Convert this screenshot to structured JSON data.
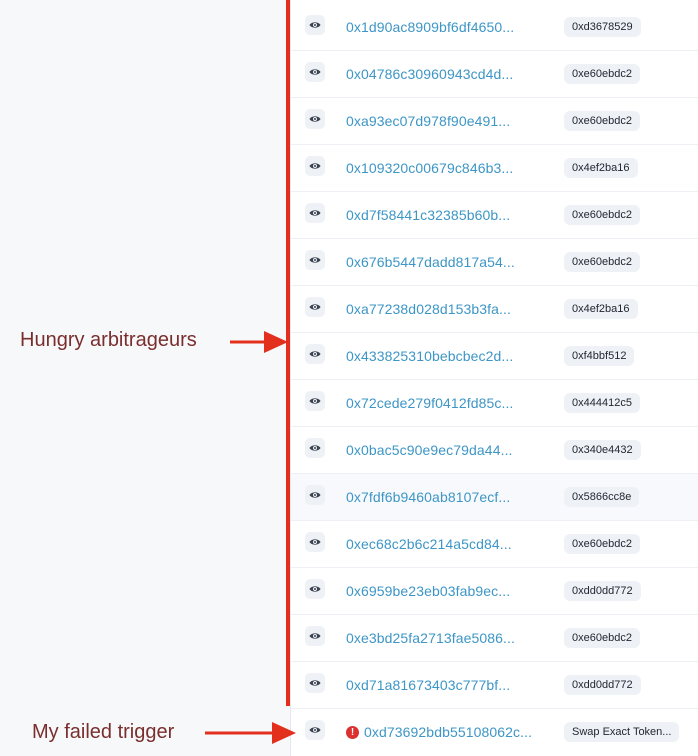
{
  "annotations": {
    "arbitrageurs": "Hungry arbitrageurs",
    "failed": "My failed trigger",
    "color": "#e3301c"
  },
  "colors": {
    "hash": "#3d96c6",
    "error": "#dc3030"
  },
  "transactions": [
    {
      "hash": "0x1d90ac8909bf6df4650...",
      "method": "0xd3678529",
      "icon": "eye-icon",
      "status": "ok"
    },
    {
      "hash": "0x04786c30960943cd4d...",
      "method": "0xe60ebdc2",
      "icon": "eye-icon",
      "status": "ok"
    },
    {
      "hash": "0xa93ec07d978f90e491...",
      "method": "0xe60ebdc2",
      "icon": "eye-icon",
      "status": "ok"
    },
    {
      "hash": "0x109320c00679c846b3...",
      "method": "0x4ef2ba16",
      "icon": "eye-icon",
      "status": "ok"
    },
    {
      "hash": "0xd7f58441c32385b60b...",
      "method": "0xe60ebdc2",
      "icon": "eye-icon",
      "status": "ok"
    },
    {
      "hash": "0x676b5447dadd817a54...",
      "method": "0xe60ebdc2",
      "icon": "eye-icon",
      "status": "ok"
    },
    {
      "hash": "0xa77238d028d153b3fa...",
      "method": "0x4ef2ba16",
      "icon": "eye-icon",
      "status": "ok"
    },
    {
      "hash": "0x433825310bebcbec2d...",
      "method": "0xf4bbf512",
      "icon": "eye-icon",
      "status": "ok"
    },
    {
      "hash": "0x72cede279f0412fd85c...",
      "method": "0x444412c5",
      "icon": "eye-icon",
      "status": "ok"
    },
    {
      "hash": "0x0bac5c90e9ec79da44...",
      "method": "0x340e4432",
      "icon": "eye-icon",
      "status": "ok"
    },
    {
      "hash": "0x7fdf6b9460ab8107ecf...",
      "method": "0x5866cc8e",
      "icon": "eye-icon",
      "status": "ok"
    },
    {
      "hash": "0xec68c2b6c214a5cd84...",
      "method": "0xe60ebdc2",
      "icon": "eye-icon",
      "status": "ok"
    },
    {
      "hash": "0x6959be23eb03fab9ec...",
      "method": "0xdd0dd772",
      "icon": "eye-icon",
      "status": "ok"
    },
    {
      "hash": "0xe3bd25fa2713fae5086...",
      "method": "0xe60ebdc2",
      "icon": "eye-icon",
      "status": "ok"
    },
    {
      "hash": "0xd71a81673403c777bf...",
      "method": "0xdd0dd772",
      "icon": "eye-icon",
      "status": "ok"
    },
    {
      "hash": "0xd73692bdb55108062c...",
      "method": "Swap Exact Token...",
      "icon": "eye-icon",
      "status": "failed"
    }
  ]
}
